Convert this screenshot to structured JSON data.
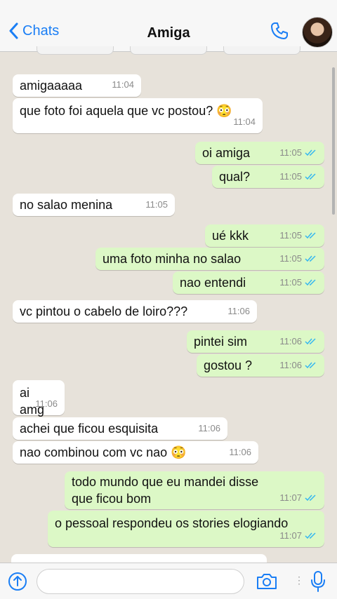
{
  "header": {
    "back_label": "Chats",
    "title": "Amiga"
  },
  "colors": {
    "accent": "#1a7ef5",
    "incoming_bubble": "#ffffff",
    "outgoing_bubble": "#dcf8c6",
    "chat_background": "#e7e2da",
    "read_ticks": "#34b7f1"
  },
  "messages": [
    {
      "direction": "in",
      "text": "amigaaaaa",
      "time": "11:04"
    },
    {
      "direction": "in",
      "text": "que foto foi aquela que vc postou? 😳",
      "time": "11:04"
    },
    {
      "direction": "out",
      "text": "oi amiga",
      "time": "11:05",
      "status": "read"
    },
    {
      "direction": "out",
      "text": "qual?",
      "time": "11:05",
      "status": "read"
    },
    {
      "direction": "in",
      "text": "no salao menina",
      "time": "11:05"
    },
    {
      "direction": "out",
      "text": "ué kkk",
      "time": "11:05",
      "status": "read"
    },
    {
      "direction": "out",
      "text": "uma foto minha no salao",
      "time": "11:05",
      "status": "read"
    },
    {
      "direction": "out",
      "text": "nao entendi",
      "time": "11:05",
      "status": "read"
    },
    {
      "direction": "in",
      "text": "vc pintou o cabelo de loiro???",
      "time": "11:06"
    },
    {
      "direction": "out",
      "text": "pintei sim",
      "time": "11:06",
      "status": "read"
    },
    {
      "direction": "out",
      "text": "gostou ?",
      "time": "11:06",
      "status": "read"
    },
    {
      "direction": "in",
      "text": "ai amg",
      "time": "11:06"
    },
    {
      "direction": "in",
      "text": "achei que ficou esquisita",
      "time": "11:06"
    },
    {
      "direction": "in",
      "text": "nao combinou com vc nao 😳",
      "time": "11:06"
    },
    {
      "direction": "out",
      "text": "todo mundo que eu mandei disse que ficou bom",
      "time": "11:07",
      "status": "read"
    },
    {
      "direction": "out",
      "text": "o pessoal respondeu os stories elogiando",
      "time": "11:07",
      "status": "read"
    }
  ],
  "input": {
    "value": "",
    "placeholder": ""
  },
  "icons": {
    "back": "chevron-left-icon",
    "call": "phone-icon",
    "attach": "plus-circle-icon",
    "camera": "camera-icon",
    "mic": "microphone-icon"
  }
}
